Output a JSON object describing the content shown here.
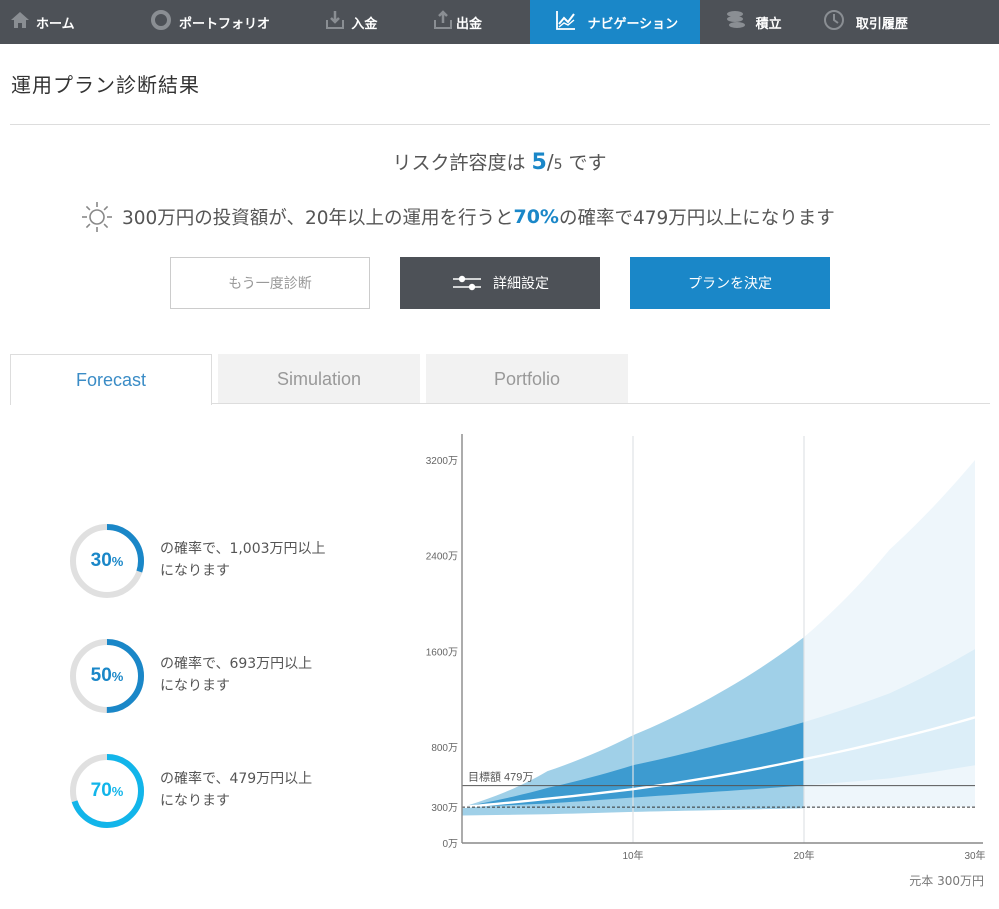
{
  "nav": {
    "items": [
      {
        "label": "ホーム",
        "icon": "home-icon",
        "active": false
      },
      {
        "label": "ポートフォリオ",
        "icon": "donut-icon",
        "active": false
      },
      {
        "label": "入金",
        "icon": "deposit-icon",
        "active": false
      },
      {
        "label": "出金",
        "icon": "withdraw-icon",
        "active": false
      },
      {
        "label": "ナビゲーション",
        "icon": "chart-line-icon",
        "active": true
      },
      {
        "label": "積立",
        "icon": "coins-icon",
        "active": false
      },
      {
        "label": "取引履歴",
        "icon": "clock-icon",
        "active": false
      }
    ]
  },
  "page": {
    "title": "運用プラン診断結果"
  },
  "risk": {
    "prefix": "リスク許容度は",
    "value": "5",
    "slash": "/",
    "max": "5",
    "suffix": "です"
  },
  "summary": {
    "part1": "300万円の投資額が、20年以上の運用を行うと",
    "percent": "70%",
    "part2": "の確率で479万円以上になります",
    "icon": "sun-icon"
  },
  "buttons": {
    "retry": "もう一度診断",
    "detail": "詳細設定",
    "decide": "プランを決定"
  },
  "tabs": [
    {
      "label": "Forecast",
      "active": true
    },
    {
      "label": "Simulation",
      "active": false
    },
    {
      "label": "Portfolio",
      "active": false
    }
  ],
  "probabilities": [
    {
      "value": "30",
      "unit": "%",
      "line1": "の確率で、1,003万円以上",
      "line2": "になります",
      "color": "#1a87c8",
      "fraction": 0.3
    },
    {
      "value": "50",
      "unit": "%",
      "line1": "の確率で、693万円以上",
      "line2": "になります",
      "color": "#1a87c8",
      "fraction": 0.5
    },
    {
      "value": "70",
      "unit": "%",
      "line1": "の確率で、479万円以上",
      "line2": "になります",
      "color": "#12b5ea",
      "fraction": 0.7
    }
  ],
  "chart_data": {
    "type": "area",
    "xlabel": "",
    "ylabel": "",
    "x_ticks": [
      {
        "value": 10,
        "label": "10年"
      },
      {
        "value": 20,
        "label": "20年"
      },
      {
        "value": 30,
        "label": "30年"
      }
    ],
    "y_ticks": [
      {
        "value": 0,
        "label": "0万"
      },
      {
        "value": 300,
        "label": "300万"
      },
      {
        "value": 800,
        "label": "800万"
      },
      {
        "value": 1600,
        "label": "1600万"
      },
      {
        "value": 2400,
        "label": "2400万"
      },
      {
        "value": 3200,
        "label": "3200万"
      }
    ],
    "xlim": [
      0,
      30
    ],
    "ylim": [
      0,
      3400
    ],
    "target": {
      "value": 479,
      "label": "目標額 479万"
    },
    "principal": {
      "value": 300
    },
    "highlight_until": 20,
    "x": [
      0,
      5,
      10,
      15,
      20,
      25,
      30
    ],
    "series": [
      {
        "role": "outer_upper",
        "values": [
          300,
          600,
          900,
          1250,
          1720,
          2450,
          3200
        ]
      },
      {
        "role": "inner_upper",
        "values": [
          300,
          460,
          650,
          820,
          1010,
          1250,
          1620
        ]
      },
      {
        "role": "median",
        "values": [
          300,
          370,
          450,
          560,
          700,
          860,
          1050
        ]
      },
      {
        "role": "inner_lower",
        "values": [
          300,
          330,
          380,
          430,
          480,
          540,
          650
        ]
      },
      {
        "role": "outer_lower",
        "values": [
          230,
          240,
          260,
          275,
          290,
          300,
          300
        ]
      }
    ],
    "colors": {
      "outer_band": "#a0d0e8",
      "inner_band": "#3d9bd0",
      "outer_band_future": "#eef6fb",
      "inner_band_future": "#dceef8",
      "median": "#ffffff"
    }
  },
  "footer": {
    "principal_note": "元本 300万円"
  }
}
